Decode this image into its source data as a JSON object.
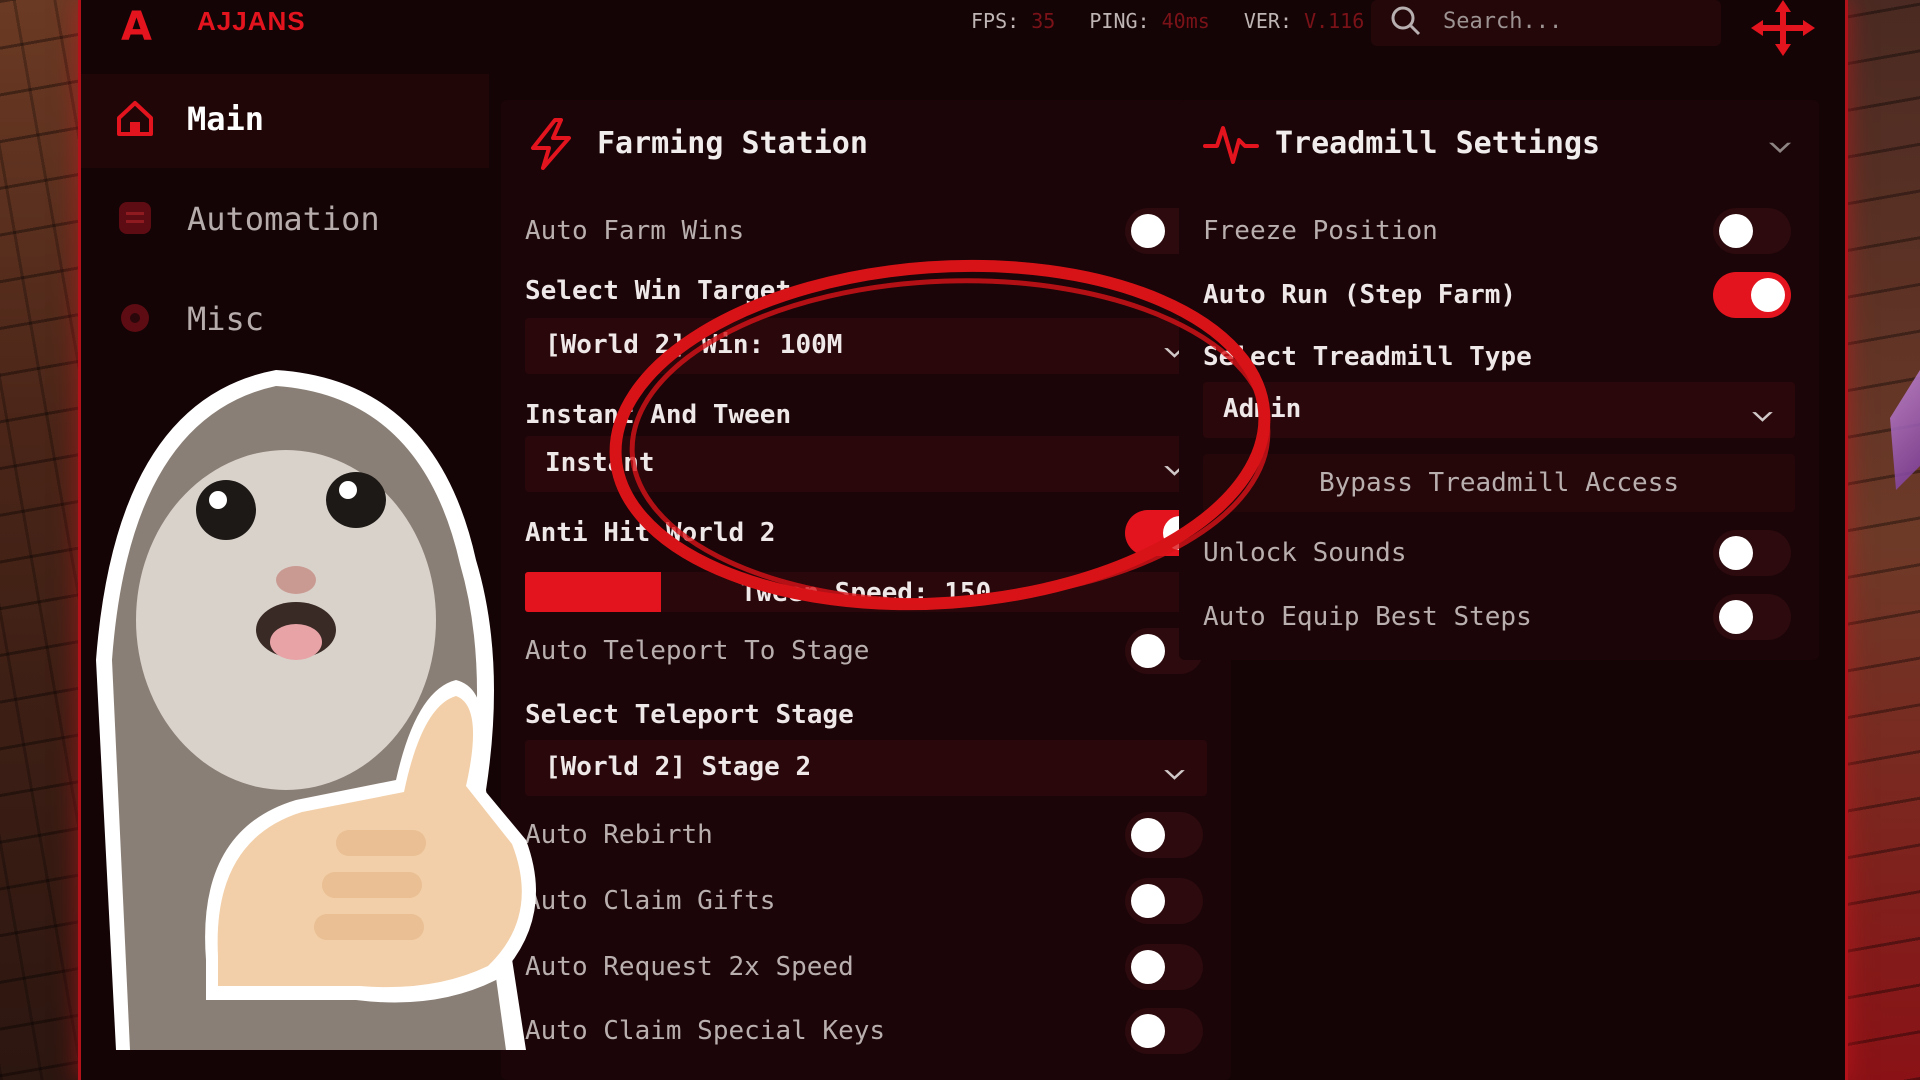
{
  "app": {
    "logo_letter": "A",
    "name": "AJJANS"
  },
  "stats": {
    "fps_label": "FPS:",
    "fps_value": "35",
    "ping_label": "PING:",
    "ping_value": "40ms",
    "ver_label": "VER:",
    "ver_value": "V.116"
  },
  "search": {
    "placeholder": "Search..."
  },
  "sidebar": {
    "items": [
      {
        "label": "Main",
        "icon": "house-icon"
      },
      {
        "label": "Automation",
        "icon": "list-icon"
      },
      {
        "label": "Misc",
        "icon": "gear-icon"
      }
    ]
  },
  "farming": {
    "title": "Farming Station",
    "auto_farm_wins": {
      "label": "Auto Farm Wins",
      "on": false
    },
    "select_win_target_label": "Select Win Target",
    "win_target_value": "[World 2] Win: 100M",
    "instant_tween_label": "Instant And Tween",
    "instant_tween_value": "Instant",
    "anti_hit": {
      "label": "Anti Hit World 2",
      "on": true
    },
    "tween_speed": {
      "label": "Tween Speed: 150",
      "fraction": 0.2
    },
    "auto_teleport": {
      "label": "Auto Teleport To Stage",
      "on": false
    },
    "select_teleport_stage_label": "Select Teleport Stage",
    "teleport_stage_value": "[World 2] Stage 2",
    "rebirth": {
      "label": "Auto Rebirth",
      "on": false
    },
    "claim_gifts": {
      "label": "Auto Claim Gifts",
      "on": false
    },
    "request_speed": {
      "label": "Auto Request 2x Speed",
      "on": false
    },
    "special_keys": {
      "label": "Auto Claim Special Keys",
      "on": false
    }
  },
  "treadmill": {
    "title": "Treadmill Settings",
    "freeze_position": {
      "label": "Freeze Position",
      "on": false
    },
    "auto_run": {
      "label": "Auto Run (Step Farm)",
      "on": true
    },
    "select_type_label": "Select Treadmill Type",
    "type_value": "Admin",
    "bypass_button": "Bypass Treadmill Access",
    "unlock_sounds": {
      "label": "Unlock Sounds",
      "on": false
    },
    "auto_equip": {
      "label": "Auto Equip Best Steps",
      "on": false
    }
  },
  "colors": {
    "accent": "#e4141e",
    "panel": "#1b0508",
    "window": "#140406"
  }
}
